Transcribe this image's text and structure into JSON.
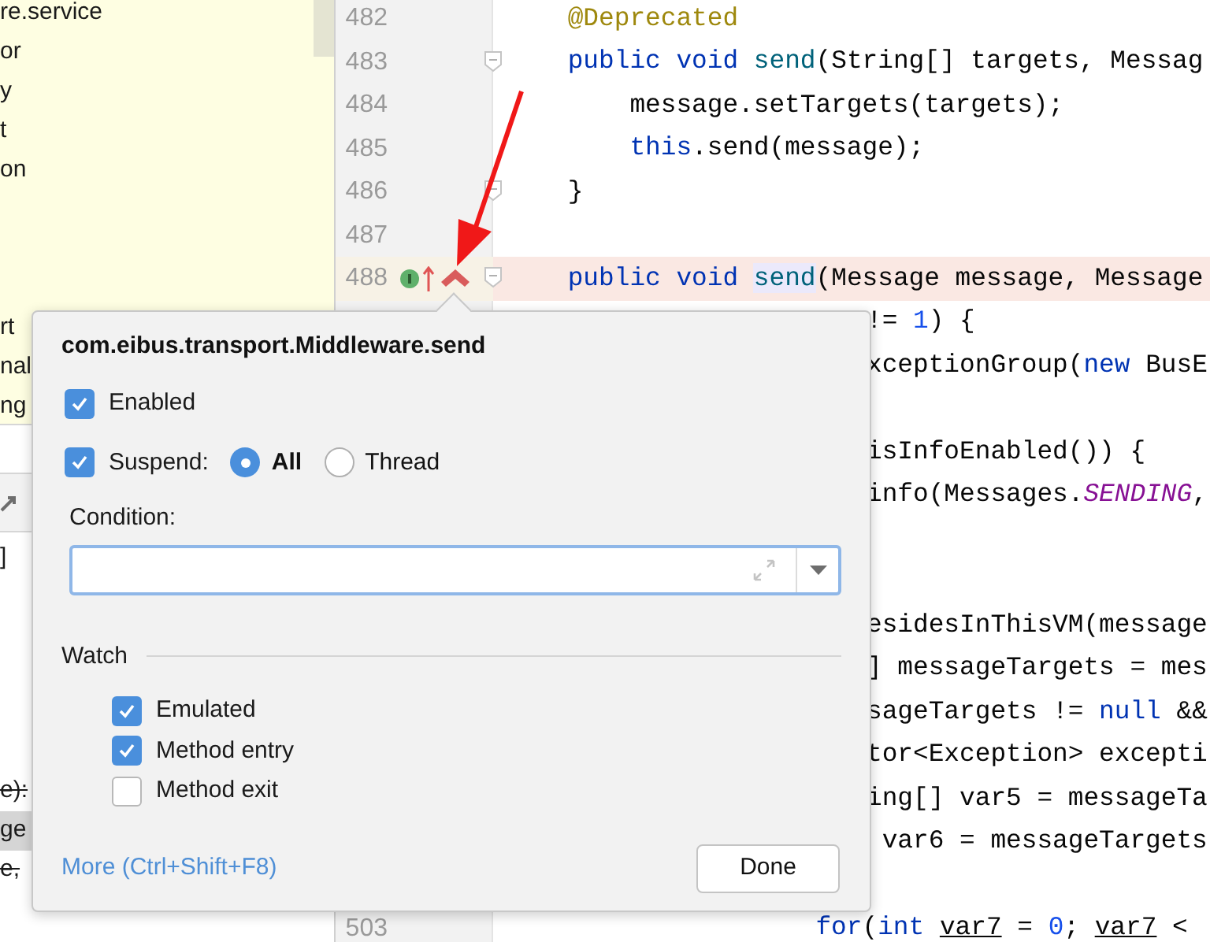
{
  "project_tree": {
    "upper_items": [
      {
        "label": "re.service"
      },
      {
        "label": "or"
      },
      {
        "label": "y"
      },
      {
        "label": "t"
      },
      {
        "label": "on"
      }
    ],
    "lower_items": [
      {
        "label": "rt"
      },
      {
        "label": "nal"
      },
      {
        "label": "ng"
      }
    ]
  },
  "structure_panel": {
    "rows": [
      {
        "label": "]",
        "deprecated": false,
        "selected": false
      },
      {
        "label": "e):",
        "deprecated": true,
        "selected": false
      },
      {
        "label": "ge",
        "deprecated": false,
        "selected": true
      },
      {
        "label": "e,",
        "deprecated": true,
        "selected": false
      }
    ]
  },
  "code_lines": [
    {
      "kind": "code",
      "number": "482",
      "segments": [
        {
          "kind": "annotation",
          "text": "    @Deprecated"
        }
      ]
    },
    {
      "kind": "code",
      "number": "483",
      "fold": true,
      "segments": [
        {
          "kind": "keyword",
          "text": "    public"
        },
        {
          "kind": "keyword",
          "text": " void "
        },
        {
          "kind": "method",
          "text": "send"
        },
        {
          "kind": "plain",
          "text": "(String[] targets, Messag"
        }
      ]
    },
    {
      "kind": "code",
      "number": "484",
      "segments": [
        {
          "kind": "plain",
          "text": "        message.setTargets(targets);"
        }
      ]
    },
    {
      "kind": "code",
      "number": "485",
      "segments": [
        {
          "kind": "keyword",
          "text": "        this"
        },
        {
          "kind": "plain",
          "text": ".send(message);"
        }
      ]
    },
    {
      "kind": "code",
      "number": "486",
      "fold": true,
      "segments": [
        {
          "kind": "plain",
          "text": "    }"
        }
      ]
    },
    {
      "kind": "blank",
      "number": "487"
    },
    {
      "kind": "code",
      "number": "488",
      "breakpoint": true,
      "fold": true,
      "segments": [
        {
          "kind": "keyword",
          "text": "    public"
        },
        {
          "kind": "keyword",
          "text": " void "
        },
        {
          "kind": "method",
          "text": "send",
          "highlighted": true
        },
        {
          "kind": "plain",
          "text": "(Message message, Message"
        }
      ]
    },
    {
      "kind": "code",
      "clipped": true,
      "segments": [
        {
          "kind": "plain",
          "text": "!= "
        },
        {
          "kind": "number",
          "text": "1"
        },
        {
          "kind": "plain",
          "text": ") {"
        }
      ]
    },
    {
      "kind": "code",
      "clipped": true,
      "segments": [
        {
          "kind": "plain",
          "text": "xceptionGroup("
        },
        {
          "kind": "keyword",
          "text": "new"
        },
        {
          "kind": "plain",
          "text": " BusE"
        }
      ]
    },
    {
      "kind": "blank"
    },
    {
      "kind": "code",
      "clipped": true,
      "segments": [
        {
          "kind": "plain",
          "text": "isInfoEnabled()) {"
        }
      ]
    },
    {
      "kind": "code",
      "clipped": true,
      "segments": [
        {
          "kind": "plain",
          "text": "info(Messages."
        },
        {
          "kind": "constant",
          "text": "SENDING"
        },
        {
          "kind": "plain",
          "text": ","
        }
      ]
    },
    {
      "kind": "blank"
    },
    {
      "kind": "blank"
    },
    {
      "kind": "code",
      "clipped": true,
      "segments": [
        {
          "kind": "plain",
          "text": "esidesInThisVM(message"
        }
      ]
    },
    {
      "kind": "code",
      "clipped": true,
      "segments": [
        {
          "kind": "plain",
          "text": "] messageTargets = mes"
        }
      ]
    },
    {
      "kind": "code",
      "clipped": true,
      "segments": [
        {
          "kind": "plain",
          "text": "sageTargets != "
        },
        {
          "kind": "keyword",
          "text": "null"
        },
        {
          "kind": "plain",
          "text": " &&"
        }
      ]
    },
    {
      "kind": "code",
      "clipped": true,
      "segments": [
        {
          "kind": "plain",
          "text": "tor<Exception> excepti"
        }
      ]
    },
    {
      "kind": "code",
      "clipped": true,
      "segments": [
        {
          "kind": "plain",
          "text": "ing[] var5 = messageTa"
        }
      ]
    },
    {
      "kind": "code",
      "clipped": true,
      "segments": [
        {
          "kind": "plain",
          "text": " var6 = messageTargets"
        }
      ]
    },
    {
      "kind": "blank"
    },
    {
      "kind": "code",
      "number": "503",
      "segments": [
        {
          "kind": "keyword",
          "text": "                    for"
        },
        {
          "kind": "plain",
          "text": "("
        },
        {
          "kind": "keyword",
          "text": "int "
        },
        {
          "kind": "variable",
          "text": "var7"
        },
        {
          "kind": "plain",
          "text": " = "
        },
        {
          "kind": "number",
          "text": "0"
        },
        {
          "kind": "plain",
          "text": "; "
        },
        {
          "kind": "variable",
          "text": "var7"
        },
        {
          "kind": "plain",
          "text": " <"
        }
      ]
    }
  ],
  "breakpoint_popup": {
    "title": "com.eibus.transport.Middleware.send",
    "enabled": {
      "label": "Enabled",
      "checked": true
    },
    "suspend": {
      "label": "Suspend:",
      "checked": true,
      "options": [
        {
          "label": "All",
          "selected": true
        },
        {
          "label": "Thread",
          "selected": false
        }
      ]
    },
    "condition": {
      "label": "Condition:"
    },
    "watch": {
      "label": "Watch",
      "items": [
        {
          "label": "Emulated",
          "checked": true
        },
        {
          "label": "Method entry",
          "checked": true
        },
        {
          "label": "Method exit",
          "checked": false
        }
      ]
    },
    "more_link": "More (Ctrl+Shift+F8)",
    "done_button": "Done"
  }
}
